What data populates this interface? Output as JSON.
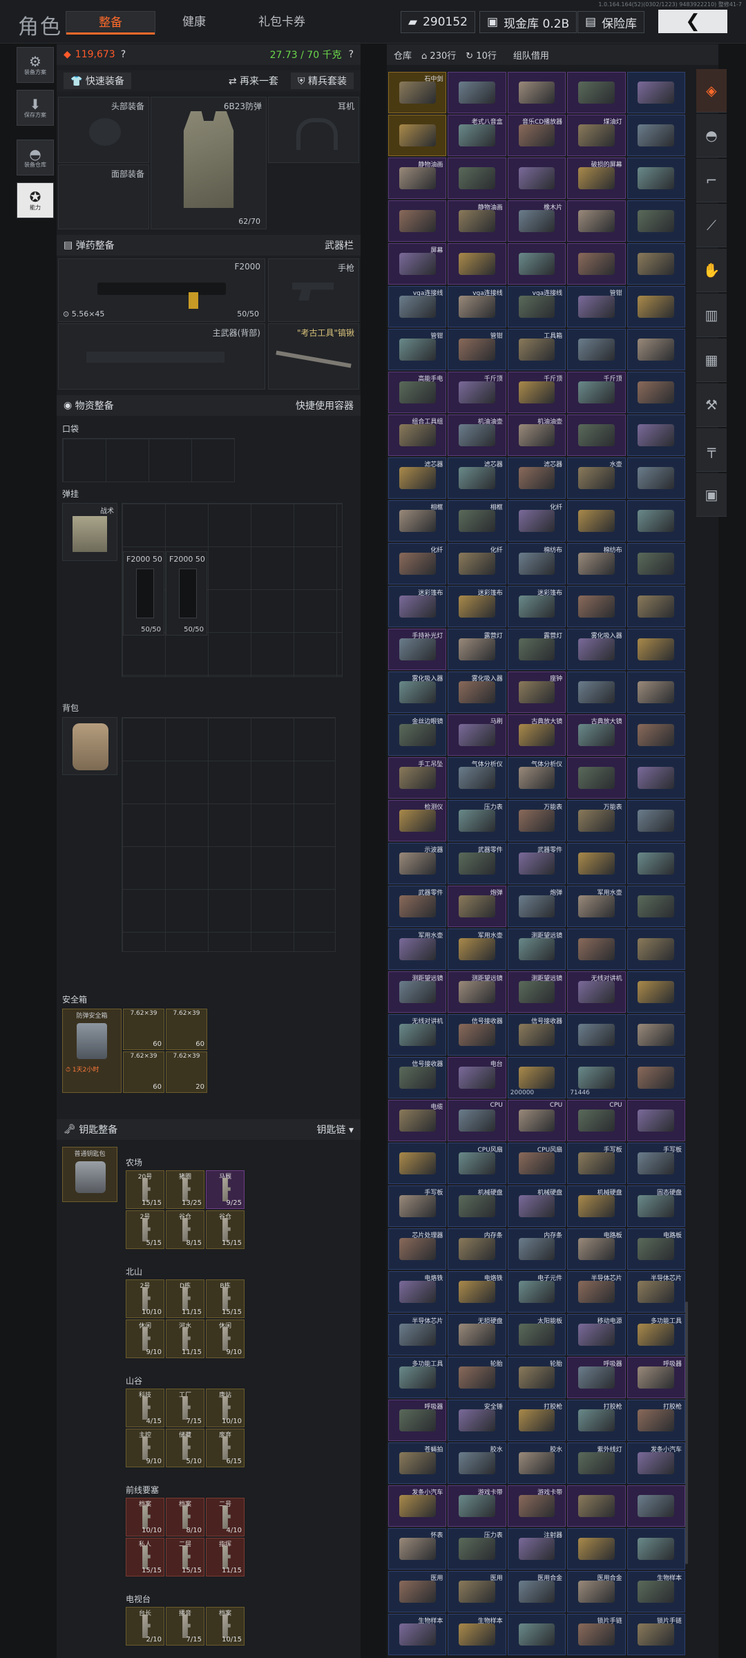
{
  "header": {
    "title": "角色",
    "tabs": [
      "整备",
      "健康",
      "礼包卡券"
    ],
    "active_tab": 0,
    "coins": "290152",
    "cash_label": "现金库 0.2B",
    "vault_label": "保险库",
    "version": "1.0.164.164(52)(0302/1223) 9483922210) 整修41-7"
  },
  "left_nav": [
    {
      "label": "装备方案",
      "icon": "loadout-icon"
    },
    {
      "label": "保存方案",
      "icon": "download-icon"
    },
    {
      "label": "装备仓库",
      "icon": "helmet-icon"
    },
    {
      "label": "能力",
      "icon": "ability-icon",
      "active": true
    }
  ],
  "equip": {
    "value": "119,673",
    "weight": "27.73 / 70 千克",
    "quick_equip": "快速装备",
    "again": "再来一套",
    "elite": "精兵套装",
    "head_label": "头部装备",
    "armor_label": "6B23防弹",
    "armor_dur": "62/70",
    "ear_label": "耳机",
    "face_label": "面部装备",
    "ammo_hdr": "弹药整备",
    "weapon_bar": "武器栏",
    "primary_name": "F2000",
    "primary_ammo": "5.56×45",
    "primary_count": "50/50",
    "pistol": "手枪",
    "back_weapon": "主武器(背部)",
    "melee": "\"考古工具\"镐锹",
    "supply_hdr": "物资整备",
    "quick_container": "快捷使用容器",
    "pocket": "口袋",
    "rig": "弹挂",
    "rig_name": "战术",
    "mag1_name": "F2000",
    "mag1_count": "50",
    "mag1_full": "50/50",
    "mag2_name": "F2000",
    "mag2_count": "50",
    "mag2_full": "50/50",
    "backpack": "背包",
    "safebox": "安全箱",
    "safebox_item": "防弹安全箱",
    "safebox_timer": "1天2小时",
    "safebox_ammo": [
      {
        "n": "7.62×39",
        "c": "60"
      },
      {
        "n": "7.62×39",
        "c": "60"
      },
      {
        "n": "7.62×39",
        "c": "60"
      },
      {
        "n": "7.62×39",
        "c": "20"
      }
    ],
    "key_hdr": "钥匙整备",
    "key_chain": "钥匙链",
    "key_holder": "普通钥匙包",
    "key_groups": [
      {
        "name": "农场",
        "keys": [
          {
            "t": "20号",
            "n": "15/15"
          },
          {
            "t": "猪圈",
            "n": "13/25"
          },
          {
            "t": "马厩",
            "n": "9/25"
          },
          {
            "t": "2号",
            "n": "5/15"
          },
          {
            "t": "谷仓",
            "n": "8/15"
          },
          {
            "t": "谷仓",
            "n": "15/15"
          }
        ]
      },
      {
        "name": "北山",
        "keys": [
          {
            "t": "2号",
            "n": "10/10"
          },
          {
            "t": "D栋",
            "n": "11/15"
          },
          {
            "t": "B栋",
            "n": "15/15"
          },
          {
            "t": "休闲",
            "n": "9/10"
          },
          {
            "t": "河水",
            "n": "11/15"
          },
          {
            "t": "休闲",
            "n": "9/10"
          }
        ]
      },
      {
        "name": "山谷",
        "keys": [
          {
            "t": "科技",
            "n": "4/15"
          },
          {
            "t": "工厂",
            "n": "7/15"
          },
          {
            "t": "唐站",
            "n": "10/10"
          },
          {
            "t": "主控",
            "n": "9/10"
          },
          {
            "t": "储藏",
            "n": "5/10"
          },
          {
            "t": "废弃",
            "n": "6/15"
          }
        ]
      },
      {
        "name": "前线要塞",
        "keys": [
          {
            "t": "档案",
            "n": "10/10"
          },
          {
            "t": "档案",
            "n": "8/10"
          },
          {
            "t": "二号",
            "n": "4/10"
          },
          {
            "t": "私人",
            "n": "15/15"
          },
          {
            "t": "二层",
            "n": "15/15"
          },
          {
            "t": "指挥",
            "n": "11/15"
          }
        ]
      },
      {
        "name": "电视台",
        "keys": [
          {
            "t": "台长",
            "n": "2/10"
          },
          {
            "t": "播音",
            "n": "7/15"
          },
          {
            "t": "档案",
            "n": "10/15"
          }
        ]
      }
    ]
  },
  "storage": {
    "title": "仓库",
    "rows": "230行",
    "refresh": "10行",
    "team": "组队借用",
    "items": [
      {
        "n": "石中剑",
        "c": "g"
      },
      {
        "n": "",
        "c": "p"
      },
      {
        "n": "",
        "c": "p"
      },
      {
        "n": "",
        "c": "p"
      },
      {
        "n": "",
        "c": "b"
      },
      {
        "n": "",
        "c": "g"
      },
      {
        "n": "老式八音盒",
        "c": "p"
      },
      {
        "n": "音乐CD播放器",
        "c": "p"
      },
      {
        "n": "煤油灯",
        "c": "p"
      },
      {
        "n": "",
        "c": "b"
      },
      {
        "n": "静物油画",
        "c": "p"
      },
      {
        "n": "",
        "c": "p"
      },
      {
        "n": "",
        "c": "p"
      },
      {
        "n": "破损的屏幕",
        "c": "p"
      },
      {
        "n": "",
        "c": "b"
      },
      {
        "n": "",
        "c": "p"
      },
      {
        "n": "静物油画",
        "c": "p"
      },
      {
        "n": "橡木片",
        "c": "p"
      },
      {
        "n": "",
        "c": "p"
      },
      {
        "n": "",
        "c": "b"
      },
      {
        "n": "屏幕",
        "c": "p"
      },
      {
        "n": "",
        "c": "p"
      },
      {
        "n": "",
        "c": "p"
      },
      {
        "n": "",
        "c": "p"
      },
      {
        "n": "",
        "c": "b"
      },
      {
        "n": "vga连接线",
        "c": "b"
      },
      {
        "n": "vga连接线",
        "c": "b"
      },
      {
        "n": "vga连接线",
        "c": "b"
      },
      {
        "n": "管钳",
        "c": "b"
      },
      {
        "n": "",
        "c": "b"
      },
      {
        "n": "管钳",
        "c": "b"
      },
      {
        "n": "管钳",
        "c": "b"
      },
      {
        "n": "工具箱",
        "c": "b"
      },
      {
        "n": "",
        "c": "b"
      },
      {
        "n": "",
        "c": "b"
      },
      {
        "n": "高能手电",
        "c": "p"
      },
      {
        "n": "千斤顶",
        "c": "p"
      },
      {
        "n": "千斤顶",
        "c": "p"
      },
      {
        "n": "千斤顶",
        "c": "p"
      },
      {
        "n": "",
        "c": "b"
      },
      {
        "n": "组合工具组",
        "c": "p"
      },
      {
        "n": "机油油壶",
        "c": "p"
      },
      {
        "n": "机油油壶",
        "c": "p"
      },
      {
        "n": "",
        "c": "p"
      },
      {
        "n": "",
        "c": "b"
      },
      {
        "n": "滤芯器",
        "c": "b"
      },
      {
        "n": "滤芯器",
        "c": "b"
      },
      {
        "n": "滤芯器",
        "c": "b"
      },
      {
        "n": "水壶",
        "c": "b"
      },
      {
        "n": "",
        "c": "b"
      },
      {
        "n": "相框",
        "c": "b"
      },
      {
        "n": "相框",
        "c": "b"
      },
      {
        "n": "化纤",
        "c": "b"
      },
      {
        "n": "",
        "c": "b"
      },
      {
        "n": "",
        "c": "b"
      },
      {
        "n": "化纤",
        "c": "b"
      },
      {
        "n": "化纤",
        "c": "b"
      },
      {
        "n": "棉纺布",
        "c": "b"
      },
      {
        "n": "棉纺布",
        "c": "b"
      },
      {
        "n": "",
        "c": "b"
      },
      {
        "n": "迷彩篷布",
        "c": "b"
      },
      {
        "n": "迷彩篷布",
        "c": "b"
      },
      {
        "n": "迷彩篷布",
        "c": "b"
      },
      {
        "n": "",
        "c": "b"
      },
      {
        "n": "",
        "c": "b"
      },
      {
        "n": "手持补光灯",
        "c": "p"
      },
      {
        "n": "露营灯",
        "c": "b"
      },
      {
        "n": "露营灯",
        "c": "b"
      },
      {
        "n": "雾化吸入器",
        "c": "b"
      },
      {
        "n": "",
        "c": "b"
      },
      {
        "n": "雾化吸入器",
        "c": "b"
      },
      {
        "n": "雾化吸入器",
        "c": "b"
      },
      {
        "n": "座钟",
        "c": "p"
      },
      {
        "n": "",
        "c": "b"
      },
      {
        "n": "",
        "c": "b"
      },
      {
        "n": "金丝边眼镜",
        "c": "b"
      },
      {
        "n": "马刷",
        "c": "p"
      },
      {
        "n": "古典放大镜",
        "c": "p"
      },
      {
        "n": "古典放大镜",
        "c": "p"
      },
      {
        "n": "",
        "c": "b"
      },
      {
        "n": "手工吊坠",
        "c": "p"
      },
      {
        "n": "气体分析仪",
        "c": "b"
      },
      {
        "n": "气体分析仪",
        "c": "b"
      },
      {
        "n": "",
        "c": "p"
      },
      {
        "n": "",
        "c": "b"
      },
      {
        "n": "检测仪",
        "c": "p"
      },
      {
        "n": "压力表",
        "c": "b"
      },
      {
        "n": "万能表",
        "c": "b"
      },
      {
        "n": "万能表",
        "c": "b"
      },
      {
        "n": "",
        "c": "b"
      },
      {
        "n": "示波器",
        "c": "b"
      },
      {
        "n": "武器零件",
        "c": "b"
      },
      {
        "n": "武器零件",
        "c": "b"
      },
      {
        "n": "",
        "c": "b"
      },
      {
        "n": "",
        "c": "b"
      },
      {
        "n": "武器零件",
        "c": "b"
      },
      {
        "n": "炮弹",
        "c": "p"
      },
      {
        "n": "炮弹",
        "c": "b"
      },
      {
        "n": "军用水壶",
        "c": "b"
      },
      {
        "n": "",
        "c": "b"
      },
      {
        "n": "军用水壶",
        "c": "b"
      },
      {
        "n": "军用水壶",
        "c": "b"
      },
      {
        "n": "测距望远镜",
        "c": "b"
      },
      {
        "n": "",
        "c": "b"
      },
      {
        "n": "",
        "c": "b"
      },
      {
        "n": "测距望远镜",
        "c": "p"
      },
      {
        "n": "测距望远镜",
        "c": "p"
      },
      {
        "n": "测距望远镜",
        "c": "p"
      },
      {
        "n": "无线对讲机",
        "c": "p"
      },
      {
        "n": "",
        "c": "b"
      },
      {
        "n": "无线对讲机",
        "c": "b"
      },
      {
        "n": "信号接收器",
        "c": "b"
      },
      {
        "n": "信号接收器",
        "c": "b"
      },
      {
        "n": "",
        "c": "b"
      },
      {
        "n": "",
        "c": "b"
      },
      {
        "n": "信号接收器",
        "c": "b"
      },
      {
        "n": "电台",
        "c": "p"
      },
      {
        "n": "",
        "c": "b",
        "q": "200000"
      },
      {
        "n": "",
        "c": "b",
        "q": "71446"
      },
      {
        "n": "",
        "c": "b"
      },
      {
        "n": "电缆",
        "c": "p"
      },
      {
        "n": "CPU",
        "c": "p"
      },
      {
        "n": "CPU",
        "c": "p"
      },
      {
        "n": "CPU",
        "c": "p"
      },
      {
        "n": "",
        "c": "p"
      },
      {
        "n": "",
        "c": "b"
      },
      {
        "n": "CPU风扇",
        "c": "b"
      },
      {
        "n": "CPU风扇",
        "c": "b"
      },
      {
        "n": "手写板",
        "c": "b"
      },
      {
        "n": "手写板",
        "c": "b"
      },
      {
        "n": "手写板",
        "c": "b"
      },
      {
        "n": "机械硬盘",
        "c": "b"
      },
      {
        "n": "机械硬盘",
        "c": "b"
      },
      {
        "n": "机械硬盘",
        "c": "b"
      },
      {
        "n": "固态硬盘",
        "c": "b"
      },
      {
        "n": "芯片处理器",
        "c": "b"
      },
      {
        "n": "内存条",
        "c": "b"
      },
      {
        "n": "内存条",
        "c": "b"
      },
      {
        "n": "电路板",
        "c": "b"
      },
      {
        "n": "电路板",
        "c": "b"
      },
      {
        "n": "电烙铁",
        "c": "b"
      },
      {
        "n": "电烙铁",
        "c": "b"
      },
      {
        "n": "电子元件",
        "c": "b"
      },
      {
        "n": "半导体芯片",
        "c": "b"
      },
      {
        "n": "半导体芯片",
        "c": "b"
      },
      {
        "n": "半导体芯片",
        "c": "b"
      },
      {
        "n": "无损硬盘",
        "c": "b"
      },
      {
        "n": "太阳能板",
        "c": "b"
      },
      {
        "n": "移动电源",
        "c": "b"
      },
      {
        "n": "多功能工具",
        "c": "b"
      },
      {
        "n": "多功能工具",
        "c": "b"
      },
      {
        "n": "轮胎",
        "c": "b"
      },
      {
        "n": "轮胎",
        "c": "b"
      },
      {
        "n": "呼吸器",
        "c": "p"
      },
      {
        "n": "呼吸器",
        "c": "p"
      },
      {
        "n": "呼吸器",
        "c": "p"
      },
      {
        "n": "安全锤",
        "c": "b"
      },
      {
        "n": "打胶枪",
        "c": "b"
      },
      {
        "n": "打胶枪",
        "c": "b"
      },
      {
        "n": "打胶枪",
        "c": "b"
      },
      {
        "n": "苍蝇拍",
        "c": "b"
      },
      {
        "n": "胶水",
        "c": "b"
      },
      {
        "n": "胶水",
        "c": "b"
      },
      {
        "n": "紫外线灯",
        "c": "b"
      },
      {
        "n": "发条小汽车",
        "c": "b"
      },
      {
        "n": "发条小汽车",
        "c": "p"
      },
      {
        "n": "游戏卡带",
        "c": "p"
      },
      {
        "n": "游戏卡带",
        "c": "p"
      },
      {
        "n": "",
        "c": "p"
      },
      {
        "n": "",
        "c": "p"
      },
      {
        "n": "怀表",
        "c": "b"
      },
      {
        "n": "压力表",
        "c": "b"
      },
      {
        "n": "注射器",
        "c": "b"
      },
      {
        "n": "",
        "c": "b"
      },
      {
        "n": "",
        "c": "b"
      },
      {
        "n": "医用",
        "c": "b"
      },
      {
        "n": "医用",
        "c": "b"
      },
      {
        "n": "医用合金",
        "c": "b"
      },
      {
        "n": "医用合金",
        "c": "b"
      },
      {
        "n": "生物样本",
        "c": "b"
      },
      {
        "n": "生物样本",
        "c": "b"
      },
      {
        "n": "生物样本",
        "c": "b"
      },
      {
        "n": "",
        "c": "b"
      },
      {
        "n": "锁片手链",
        "c": "b"
      },
      {
        "n": "锁片手链",
        "c": "b"
      }
    ]
  },
  "right_nav": [
    "bag-icon",
    "helmet-icon",
    "rifle-icon",
    "knife-icon",
    "hand-icon",
    "vest-icon",
    "box-icon",
    "wrench-icon",
    "gun-icon",
    "crate-icon"
  ]
}
